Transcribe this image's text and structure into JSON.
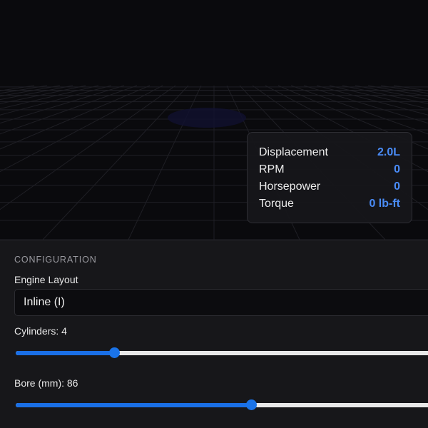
{
  "stats": {
    "displacement_label": "Displacement",
    "displacement_value": "2.0L",
    "rpm_label": "RPM",
    "rpm_value": "0",
    "horsepower_label": "Horsepower",
    "horsepower_value": "0",
    "torque_label": "Torque",
    "torque_value": "0 lb-ft"
  },
  "config": {
    "section_title": "CONFIGURATION",
    "layout_label": "Engine Layout",
    "layout_selected": "Inline (I)",
    "cylinders_label": "Cylinders: 4",
    "cylinders_fraction": 0.23,
    "bore_label": "Bore (mm): 86",
    "bore_fraction": 0.55
  },
  "colors": {
    "accent": "#1a73e8",
    "value_text": "#4a8cf7",
    "panel_bg": "#17171a",
    "viewport_bg": "#0a0a0d"
  },
  "icons": {
    "viewport": "grid-floor"
  }
}
